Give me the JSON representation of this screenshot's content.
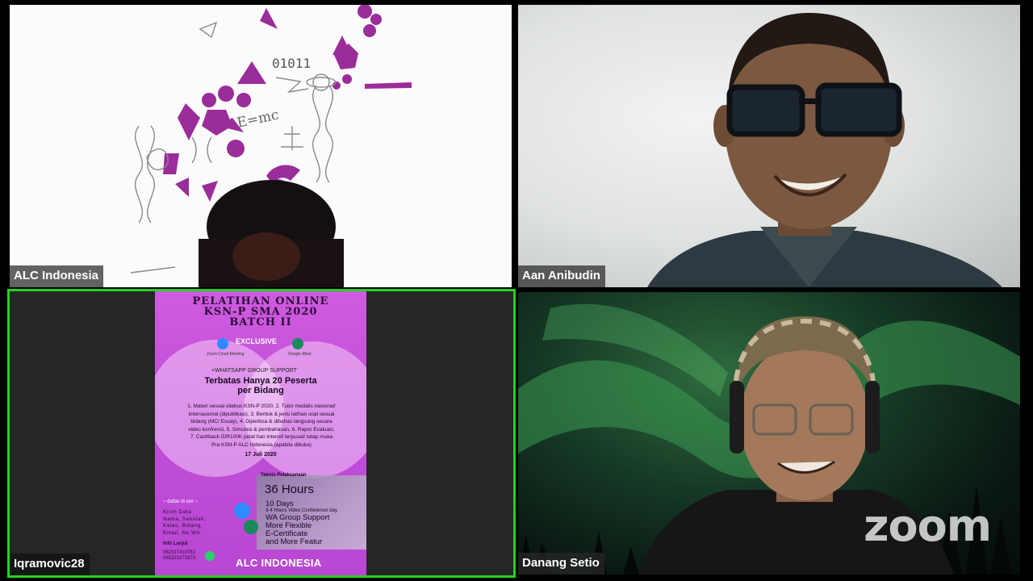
{
  "participants": [
    {
      "name": "ALC Indonesia"
    },
    {
      "name": "Aan Anibudin"
    },
    {
      "name": "Iqramovic28"
    },
    {
      "name": "Danang Setio"
    }
  ],
  "shared_content": {
    "title_lines": [
      "PELATIHAN ONLINE",
      "KSN-P SMA 2020",
      "BATCH II"
    ],
    "exclusive": "EXCLUSIVE",
    "icon_left_label": "Zoom Cloud Meeting",
    "icon_right_label": "Google Meet",
    "wa_line": "+WHATSAPP GROUP SUPPORT",
    "headline_lines": [
      "Terbatas Hanya 20 Peserta",
      "per Bidang"
    ],
    "body_lines": [
      "1. Materi sesuai silabus KSN-P 2020, 2. Tutor medalis nasional/",
      "internasional (dipublikasi), 3. Bentuk & jenis latihan soal sesuai",
      "bidang (MC/ Essay), 4. Diperiksa & dibahas langsung  secara",
      "video konfrensi, 5. Simulasi & pembahasan, 6. Rapor Evaluasi,",
      "7. Cashback  IDR100K pelat han intensif terpusat/ tatap muka",
      "Pra KSN-P ALC Indonesia (apabila dibuka)"
    ],
    "date": "17 Juli 2020",
    "teknis": "Teknis Pelaksanaan",
    "hours": "36 Hours",
    "features": [
      "10 Days",
      "3-4 Hours Video Conference/ day",
      "WA Group Support",
      "More Flexible",
      "E-Certificate",
      "and More Featur"
    ],
    "daftar": "~ daftar di sini ~",
    "kirim_lines": [
      "Kirim Data",
      "Nama, Sekolah,",
      "Kelas, Bidang,",
      "Email, No WA."
    ],
    "info": "Info Lanjut",
    "phones": [
      "082317410783",
      "085223273373"
    ],
    "brand": "ALC INDONESIA"
  },
  "tile1_formula": "E=mc",
  "tile1_binary": "01011",
  "watermark": "zoom",
  "colors": {
    "active_speaker_border": "#22d31f",
    "poster_bg": "#c14fd9",
    "art_accent": "#9a2d9a"
  }
}
